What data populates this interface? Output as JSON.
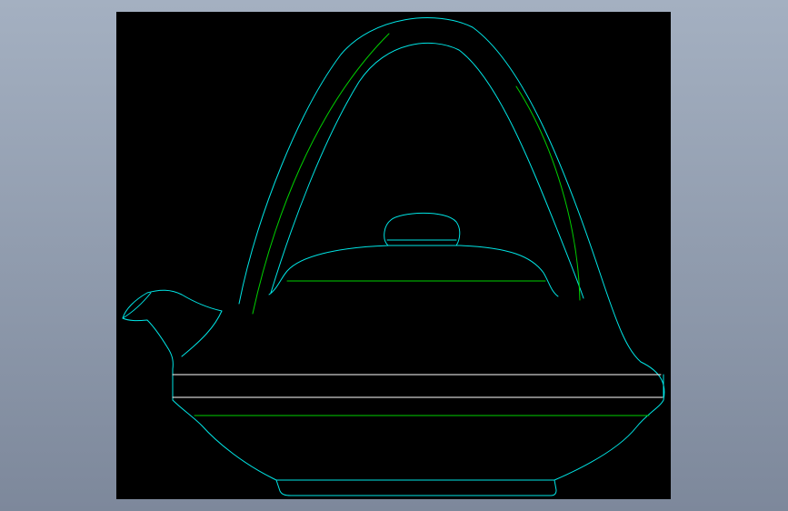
{
  "colors": {
    "background_gradient_top": "#a4b0c1",
    "background_gradient_bottom": "#7d889b",
    "viewport": "#000000",
    "outline": "#00e5e5",
    "inner_detail": "#00d000",
    "band": "#ffffff"
  },
  "drawing": {
    "subject": "teapot-cad-outline",
    "parts": [
      "handle",
      "lid",
      "lid-knob",
      "spout",
      "body",
      "bands",
      "foot"
    ]
  }
}
